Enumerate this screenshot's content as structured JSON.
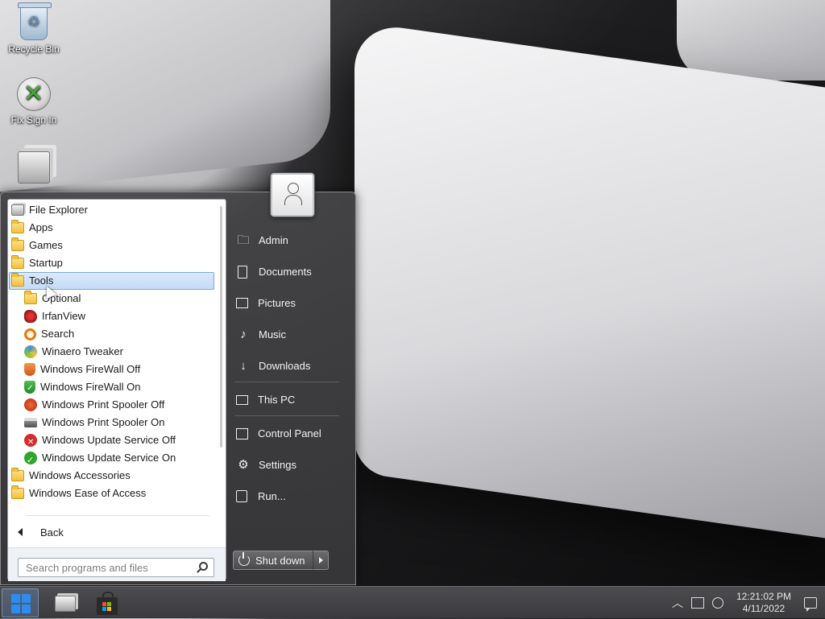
{
  "desktop": {
    "icons": [
      {
        "label": "Recycle Bin",
        "icon": "recycle-bin-icon"
      },
      {
        "label": "Fix Sign In",
        "icon": "xbox-icon"
      },
      {
        "label": "",
        "icon": "file-explorer-icon"
      }
    ]
  },
  "start_menu": {
    "programs": [
      {
        "label": "File Explorer",
        "icon": "file-explorer-icon",
        "level": 0
      },
      {
        "label": "Apps",
        "icon": "folder-icon",
        "level": 0
      },
      {
        "label": "Games",
        "icon": "folder-icon",
        "level": 0
      },
      {
        "label": "Startup",
        "icon": "folder-icon",
        "level": 0
      },
      {
        "label": "Tools",
        "icon": "folder-icon",
        "level": 0,
        "selected": true
      },
      {
        "label": "Optional",
        "icon": "folder-icon",
        "level": 1
      },
      {
        "label": "IrfanView",
        "icon": "irfanview-icon",
        "level": 1
      },
      {
        "label": "Search",
        "icon": "search-icon",
        "level": 1
      },
      {
        "label": "Winaero Tweaker",
        "icon": "winaero-icon",
        "level": 1
      },
      {
        "label": "Windows FireWall Off",
        "icon": "shield-off-icon",
        "level": 1
      },
      {
        "label": "Windows FireWall On",
        "icon": "shield-on-icon",
        "level": 1
      },
      {
        "label": "Windows Print Spooler Off",
        "icon": "spooler-off-icon",
        "level": 1
      },
      {
        "label": "Windows Print Spooler On",
        "icon": "printer-icon",
        "level": 1
      },
      {
        "label": "Windows Update Service Off",
        "icon": "update-off-icon",
        "level": 1
      },
      {
        "label": "Windows Update Service On",
        "icon": "update-on-icon",
        "level": 1
      },
      {
        "label": "Windows Accessories",
        "icon": "folder-icon",
        "level": 0
      },
      {
        "label": "Windows Ease of Access",
        "icon": "folder-icon",
        "level": 0
      }
    ],
    "back_label": "Back",
    "search_placeholder": "Search programs and files",
    "user_icon": "user-icon",
    "right_items": [
      {
        "label": "Admin",
        "icon": "user-folder-icon"
      },
      {
        "label": "Documents",
        "icon": "document-icon"
      },
      {
        "label": "Pictures",
        "icon": "picture-icon"
      },
      {
        "label": "Music",
        "icon": "music-icon"
      },
      {
        "label": "Downloads",
        "icon": "download-icon"
      },
      {
        "label": "This PC",
        "icon": "computer-icon"
      },
      {
        "label": "Control Panel",
        "icon": "control-panel-icon"
      },
      {
        "label": "Settings",
        "icon": "gear-icon"
      },
      {
        "label": "Run...",
        "icon": "run-icon"
      }
    ],
    "shutdown_label": "Shut down"
  },
  "taskbar": {
    "start_icon": "windows-logo-icon",
    "pinned": [
      {
        "icon": "file-explorer-icon"
      },
      {
        "icon": "store-icon"
      }
    ],
    "clock_time": "12:21:02 PM",
    "clock_date": "4/11/2022"
  },
  "colors": {
    "accent": "#2d8cf0",
    "selection": "#c3dcf7"
  }
}
